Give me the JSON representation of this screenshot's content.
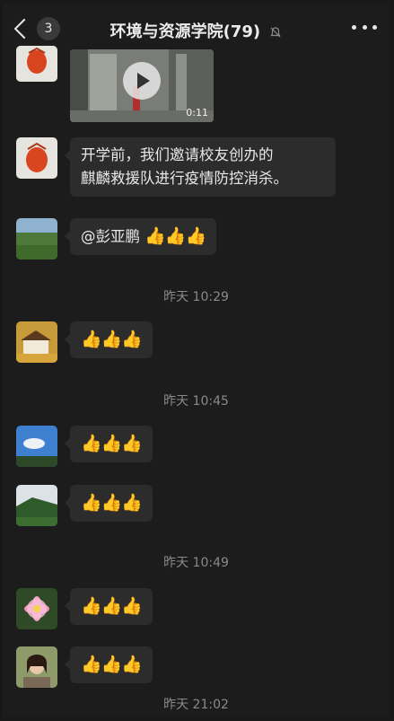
{
  "header": {
    "back_count": "3",
    "title": "环境与资源学院(79)"
  },
  "video": {
    "duration": "0:11"
  },
  "messages": {
    "text1": "开学前，我们邀请校友创办的",
    "text1b": "麒麟救援队进行疫情防控消杀。",
    "mention": "@彭亚鹏",
    "thumbs": "👍👍👍"
  },
  "timestamps": {
    "t1": "昨天 10:29",
    "t2": "昨天 10:45",
    "t3": "昨天 10:49",
    "t4": "昨天 21:02"
  },
  "icons": {
    "back": "chevron-left-icon",
    "mute": "bell-muted-icon",
    "more": "more-dots-icon",
    "play": "play-icon"
  }
}
